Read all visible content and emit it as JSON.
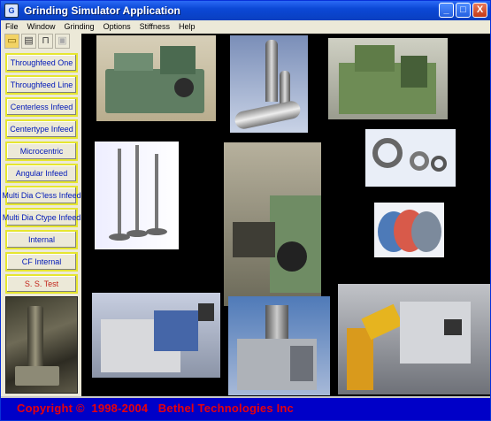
{
  "window": {
    "title": "Grinding Simulator  Application",
    "icon": "app-icon",
    "controls": [
      "_",
      "□",
      "X"
    ]
  },
  "menu": [
    "File",
    "Window",
    "Grinding",
    "Options",
    "Stiffness",
    "Help"
  ],
  "toolbar": [
    {
      "name": "open-folder-icon"
    },
    {
      "name": "print-icon"
    },
    {
      "name": "machine-icon"
    },
    {
      "name": "save-disabled-icon"
    }
  ],
  "sidebar": {
    "buttons": [
      "Throughfeed One",
      "Throughfeed Line",
      "Centerless Infeed",
      "Centertype Infeed",
      "Microcentric",
      "Angular Infeed",
      "Multi Dia C'less Infeed",
      "Multi Dia Ctype Infeed",
      "Internal",
      "CF Internal",
      "S. S. Test"
    ],
    "active_index": 10
  },
  "photos": [
    {
      "name": "grinding-machine-photo-1",
      "desc_icon": "machine"
    },
    {
      "name": "cylindrical-parts-photo"
    },
    {
      "name": "grinding-machine-photo-2"
    },
    {
      "name": "engine-valves-photo"
    },
    {
      "name": "grinding-head-closeup-photo"
    },
    {
      "name": "bearings-photo"
    },
    {
      "name": "grinding-wheels-photo"
    },
    {
      "name": "grinding-machine-photo-3"
    },
    {
      "name": "grinding-machine-photo-4"
    },
    {
      "name": "robotic-grinding-cell-photo"
    }
  ],
  "footer": {
    "copyright": "Copyright ©  1998-2004   Bethel Technologies Inc"
  },
  "colors": {
    "titlebar": "#0b48d6",
    "footer_bg": "#0000c8",
    "footer_text": "#e8000c",
    "nav_text": "#0018b8",
    "nav_border": "#e6e630",
    "active_nav_text": "#c2231a"
  }
}
